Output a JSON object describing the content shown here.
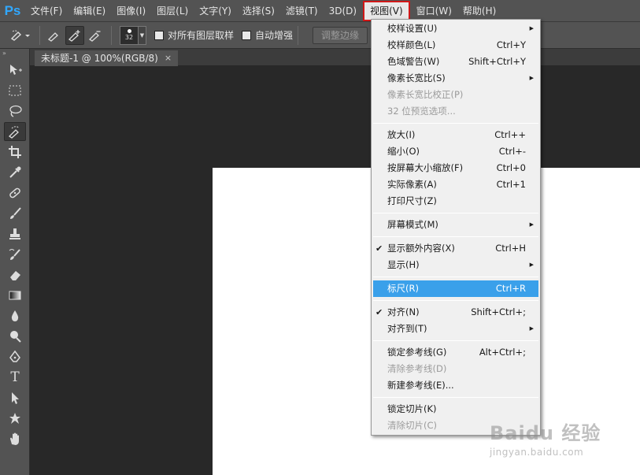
{
  "app": {
    "logo": "Ps"
  },
  "menubar": {
    "items": [
      "文件(F)",
      "编辑(E)",
      "图像(I)",
      "图层(L)",
      "文字(Y)",
      "选择(S)",
      "滤镜(T)",
      "3D(D)",
      "视图(V)",
      "窗口(W)",
      "帮助(H)"
    ],
    "active": "视图(V)"
  },
  "options": {
    "brush_size": "32",
    "sample_all_layers": "对所有图层取样",
    "auto_enhance": "自动增强",
    "refine_edge": "调整边缘"
  },
  "document": {
    "tab_title": "未标题-1 @ 100%(RGB/8)",
    "close": "×"
  },
  "menu": {
    "groups": [
      [
        {
          "label": "校样设置(U)",
          "shortcut": "",
          "submenu": true
        },
        {
          "label": "校样颜色(L)",
          "shortcut": "Ctrl+Y"
        },
        {
          "label": "色域警告(W)",
          "shortcut": "Shift+Ctrl+Y"
        },
        {
          "label": "像素长宽比(S)",
          "shortcut": "",
          "submenu": true
        },
        {
          "label": "像素长宽比校正(P)",
          "shortcut": "",
          "disabled": true
        },
        {
          "label": "32 位预览选项...",
          "shortcut": "",
          "disabled": true
        }
      ],
      [
        {
          "label": "放大(I)",
          "shortcut": "Ctrl++"
        },
        {
          "label": "缩小(O)",
          "shortcut": "Ctrl+-"
        },
        {
          "label": "按屏幕大小缩放(F)",
          "shortcut": "Ctrl+0"
        },
        {
          "label": "实际像素(A)",
          "shortcut": "Ctrl+1"
        },
        {
          "label": "打印尺寸(Z)",
          "shortcut": ""
        }
      ],
      [
        {
          "label": "屏幕模式(M)",
          "shortcut": "",
          "submenu": true
        }
      ],
      [
        {
          "label": "显示额外内容(X)",
          "shortcut": "Ctrl+H",
          "checked": true
        },
        {
          "label": "显示(H)",
          "shortcut": "",
          "submenu": true
        }
      ],
      [
        {
          "label": "标尺(R)",
          "shortcut": "Ctrl+R",
          "highlighted": true
        }
      ],
      [
        {
          "label": "对齐(N)",
          "shortcut": "Shift+Ctrl+;",
          "checked": true
        },
        {
          "label": "对齐到(T)",
          "shortcut": "",
          "submenu": true
        }
      ],
      [
        {
          "label": "锁定参考线(G)",
          "shortcut": "Alt+Ctrl+;"
        },
        {
          "label": "清除参考线(D)",
          "shortcut": "",
          "disabled": true
        },
        {
          "label": "新建参考线(E)...",
          "shortcut": ""
        }
      ],
      [
        {
          "label": "锁定切片(K)",
          "shortcut": ""
        },
        {
          "label": "清除切片(C)",
          "shortcut": "",
          "disabled": true
        }
      ]
    ]
  },
  "watermark": {
    "main": "Baidu 经验",
    "sub": "jingyan.baidu.com"
  },
  "colors": {
    "accent": "#3aa0ea",
    "highlight_border": "#d01818",
    "ps_blue": "#31a8ff"
  }
}
